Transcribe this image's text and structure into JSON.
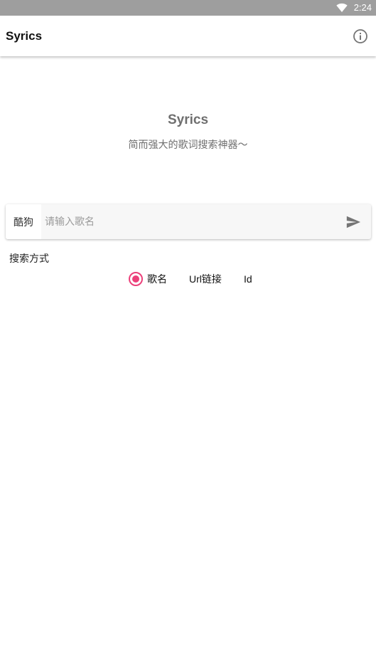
{
  "status_bar": {
    "time": "2:24",
    "wifi_icon": "wifi-icon"
  },
  "app_bar": {
    "title": "Syrics",
    "info_icon": "info-icon"
  },
  "hero": {
    "title": "Syrics",
    "subtitle": "简而强大的歌词搜索神器～"
  },
  "search": {
    "source": "酷狗",
    "placeholder": "请输入歌名",
    "value": "",
    "send_icon": "send-icon"
  },
  "search_mode": {
    "label": "搜索方式",
    "options": [
      {
        "label": "歌名",
        "selected": true
      },
      {
        "label": "Url链接",
        "selected": false
      },
      {
        "label": "Id",
        "selected": false
      }
    ]
  },
  "colors": {
    "accent": "#ec407a",
    "status_bar": "#9e9e9e",
    "hero_text": "#6f6f6f"
  }
}
